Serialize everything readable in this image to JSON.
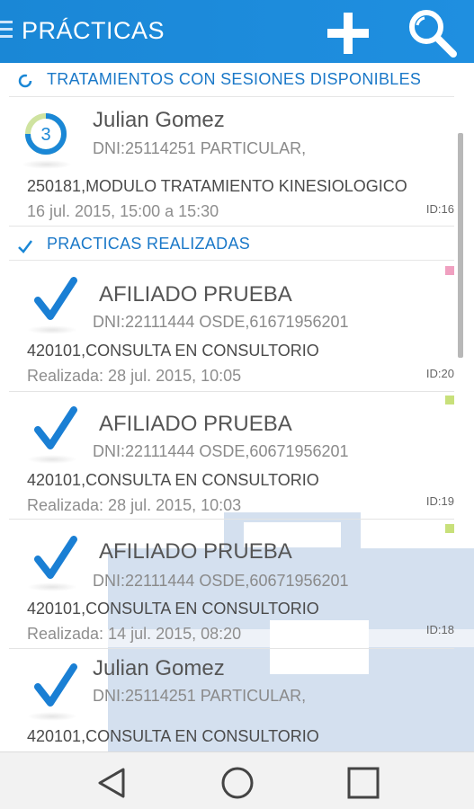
{
  "appbar": {
    "title": "PRÁCTICAS",
    "menu_icon": "hamburger-icon",
    "add_icon": "plus-icon",
    "search_icon": "search-icon",
    "color": "#1f8fe0"
  },
  "sections": {
    "available": {
      "label": "TRATAMIENTOS CON SESIONES DISPONIBLES",
      "icon": "progress-ring-icon"
    },
    "done": {
      "label": "PRACTICAS REALIZADAS",
      "icon": "checkmark-icon"
    }
  },
  "treatment": {
    "sessions": "3",
    "name": "Julian Gomez",
    "dni": "DNI:25114251 PARTICULAR,",
    "practice": "250181,MODULO TRATAMIENTO KINESIOLOGICO",
    "date": "16 jul. 2015, 15:00 a 15:30",
    "id": "ID:16"
  },
  "practices": [
    {
      "name": "AFILIADO PRUEBA",
      "dni": "DNI:22111444 OSDE,61671956201",
      "practice": "420101,CONSULTA EN CONSULTORIO",
      "date": "Realizada: 28 jul. 2015, 10:05",
      "id": "ID:20",
      "flag_color": "#f0a0c0"
    },
    {
      "name": "AFILIADO PRUEBA",
      "dni": "DNI:22111444 OSDE,60671956201",
      "practice": "420101,CONSULTA EN CONSULTORIO",
      "date": "Realizada: 28 jul. 2015, 10:03",
      "id": "ID:19",
      "flag_color": "#c8e07a"
    },
    {
      "name": "AFILIADO PRUEBA",
      "dni": "DNI:22111444 OSDE,60671956201",
      "practice": "420101,CONSULTA EN CONSULTORIO",
      "date": "Realizada: 14 jul. 2015, 08:20",
      "id": "ID:18",
      "flag_color": "#c8e07a"
    },
    {
      "name": "Julian Gomez",
      "dni": "DNI:25114251 PARTICULAR,",
      "practice": "420101,CONSULTA EN CONSULTORIO"
    }
  ],
  "navbar": {
    "back_icon": "back-triangle-icon",
    "home_icon": "home-circle-icon",
    "recents_icon": "recents-square-icon"
  }
}
